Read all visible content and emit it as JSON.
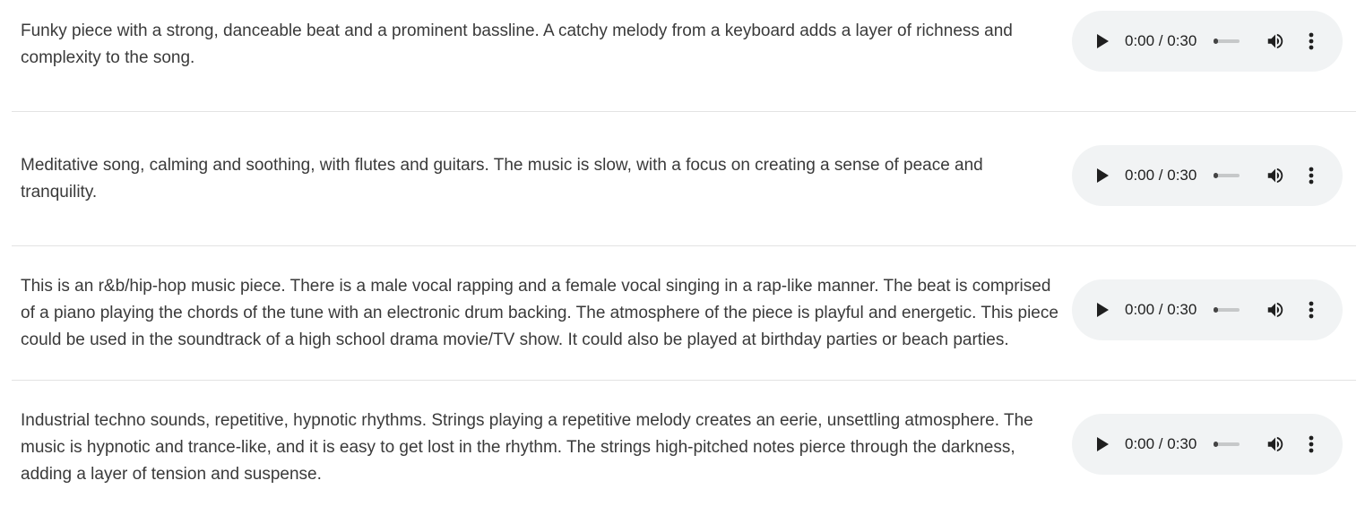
{
  "tracks": [
    {
      "description": "Funky piece with a strong, danceable beat and a prominent bassline. A catchy melody from a keyboard adds a layer of richness and complexity to the song.",
      "player": {
        "time": "0:00 / 0:30",
        "progress": 0.0
      }
    },
    {
      "description": "Meditative song, calming and soothing, with flutes and guitars. The music is slow, with a focus on creating a sense of peace and tranquility.",
      "player": {
        "time": "0:00 / 0:30",
        "progress": 0.0
      }
    },
    {
      "description": "This is an r&b/hip-hop music piece. There is a male vocal rapping and a female vocal singing in a rap-like manner. The beat is comprised of a piano playing the chords of the tune with an electronic drum backing. The atmosphere of the piece is playful and energetic. This piece could be used in the soundtrack of a high school drama movie/TV show. It could also be played at birthday parties or beach parties.",
      "player": {
        "time": "0:00 / 0:30",
        "progress": 0.0
      }
    },
    {
      "description": "Industrial techno sounds, repetitive, hypnotic rhythms. Strings playing a repetitive melody creates an eerie, unsettling atmosphere. The music is hypnotic and trance-like, and it is easy to get lost in the rhythm. The strings high-pitched notes pierce through the darkness, adding a layer of tension and suspense.",
      "player": {
        "time": "0:00 / 0:30",
        "progress": 0.0
      }
    }
  ],
  "icons": {
    "play": "play-icon",
    "volume": "volume-icon",
    "menu": "more-vertical-icon"
  },
  "colors": {
    "player_bg": "#f1f3f4",
    "icon": "#1f1f1f",
    "separator": "#e3e3e3",
    "text": "#3a3a3a"
  }
}
